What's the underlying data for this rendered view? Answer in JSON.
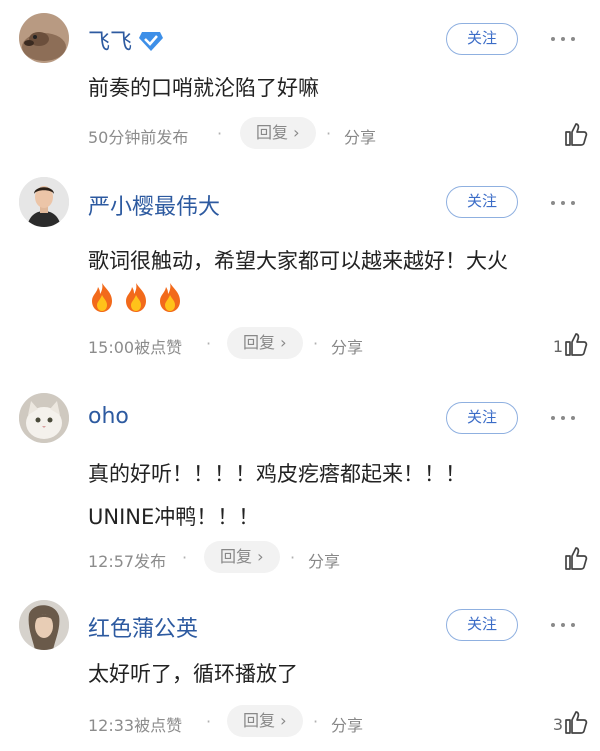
{
  "comments": [
    {
      "username": "飞飞",
      "verified": true,
      "follow_label": "关注",
      "content_lines": [
        "前奏的口哨就沦陷了好嘛"
      ],
      "time": "50分钟前发布",
      "reply_label": "回复",
      "share_label": "分享",
      "like_count": ""
    },
    {
      "username": "严小樱最伟大",
      "verified": false,
      "follow_label": "关注",
      "content_lines": [
        "歌词很触动，希望大家都可以越来越好！大火"
      ],
      "flames": [
        "🔥",
        "🔥",
        "🔥"
      ],
      "time": "15:00被点赞",
      "reply_label": "回复",
      "share_label": "分享",
      "like_count": "1"
    },
    {
      "username": "oho",
      "verified": false,
      "follow_label": "关注",
      "content_lines": [
        "真的好听！！！！鸡皮疙瘩都起来！！！",
        "UNINE冲鸭！！！"
      ],
      "time": "12:57发布",
      "reply_label": "回复",
      "share_label": "分享",
      "like_count": ""
    },
    {
      "username": "红色蒲公英",
      "verified": false,
      "follow_label": "关注",
      "content_lines": [
        "太好听了，循环播放了"
      ],
      "time": "12:33被点赞",
      "reply_label": "回复",
      "share_label": "分享",
      "like_count": "3"
    }
  ],
  "glyphs": {
    "reply_chevron": "›",
    "separator": "·"
  },
  "colors": {
    "username": "#2d5aa0",
    "follow_border": "#8fb0e0",
    "follow_text": "#3b6cc7",
    "meta": "#8c8c8c"
  },
  "icons": [
    "verified-badge-icon",
    "more-icon",
    "thumbs-up-icon",
    "fire-icon"
  ]
}
